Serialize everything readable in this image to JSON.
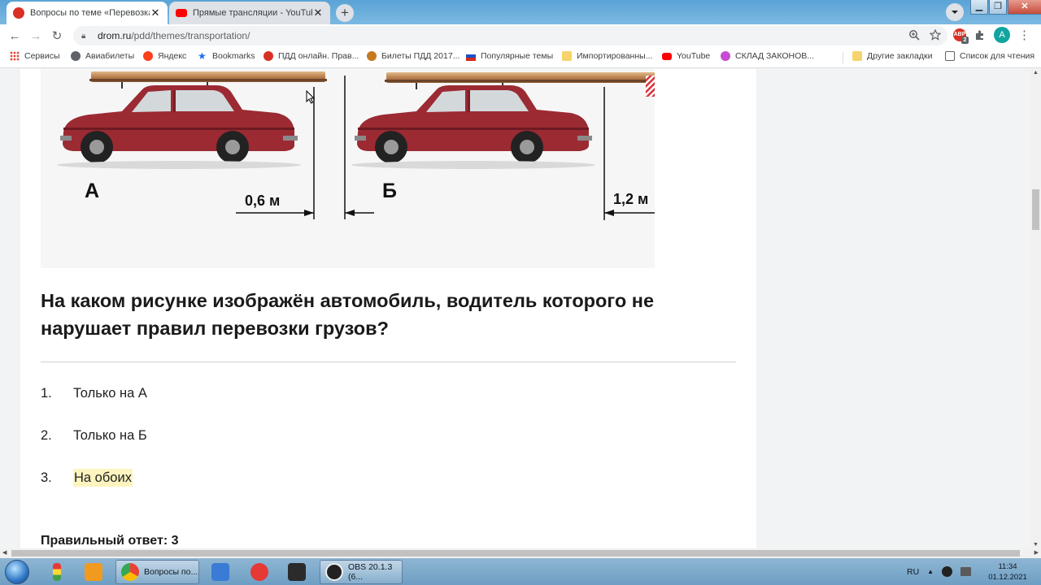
{
  "browser": {
    "tabs": [
      {
        "title": "Вопросы по теме «Перевозка л",
        "active": true
      },
      {
        "title": "Прямые трансляции - YouTube",
        "active": false
      }
    ],
    "url_host": "drom.ru",
    "url_path": "/pdd/themes/transportation/"
  },
  "bookmarks": {
    "items": [
      {
        "label": "Сервисы",
        "icon": "apps-grid-icon"
      },
      {
        "label": "Авиабилеты",
        "icon": "globe-icon"
      },
      {
        "label": "Яндекс",
        "icon": "yandex-icon"
      },
      {
        "label": "Bookmarks",
        "icon": "star-icon"
      },
      {
        "label": "ПДД онлайн. Прав...",
        "icon": "drom-icon"
      },
      {
        "label": "Билеты ПДД 2017...",
        "icon": "badge-icon"
      },
      {
        "label": "Популярные темы",
        "icon": "flag-icon"
      },
      {
        "label": "Импортированны...",
        "icon": "folder-icon"
      },
      {
        "label": "YouTube",
        "icon": "youtube-icon"
      },
      {
        "label": "СКЛАД ЗАКОНОВ...",
        "icon": "lotus-icon"
      }
    ],
    "other_bookmarks": "Другие закладки",
    "reading_list": "Список для чтения"
  },
  "figure": {
    "label_a": "А",
    "label_b": "Б",
    "dim_a": "0,6 м",
    "dim_b": "1,2 м"
  },
  "question": {
    "text": "На каком рисунке изображён автомобиль, водитель которого не нарушает правил перевозки грузов?",
    "options": [
      {
        "num": "1.",
        "text": "Только на А"
      },
      {
        "num": "2.",
        "text": "Только на Б"
      },
      {
        "num": "3.",
        "text": "На обоих"
      }
    ],
    "answer": "Правильный ответ: 3"
  },
  "taskbar": {
    "chrome_label": "Вопросы по...",
    "obs_label": "OBS 20.1.3 (6...",
    "lang": "RU",
    "time": "11:34",
    "date": "01.12.2021"
  },
  "colors": {
    "car_body": "#9b2a33",
    "highlight": "#fdf4bf",
    "accent_red": "#d93025"
  }
}
